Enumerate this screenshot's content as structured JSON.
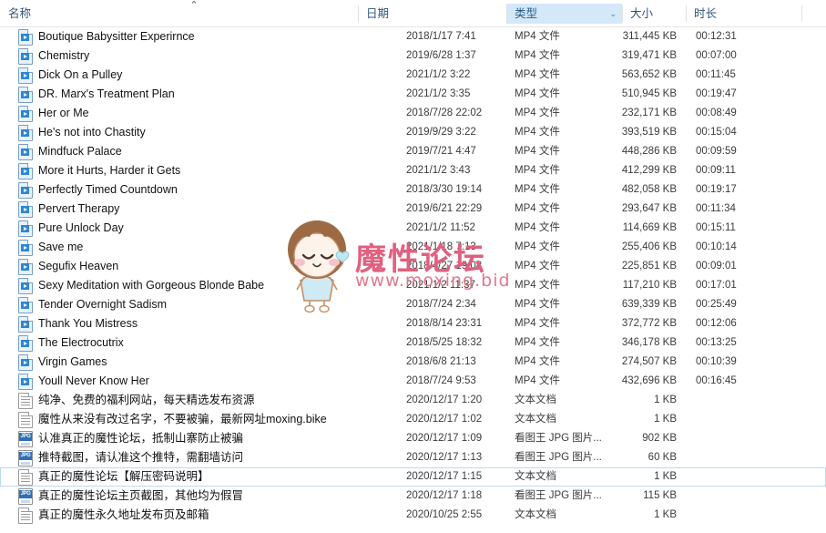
{
  "columns": {
    "name": "名称",
    "date": "日期",
    "type": "类型",
    "size": "大小",
    "duration": "时长",
    "sort_indicator": "⌃",
    "type_filter_chevron": "⌄"
  },
  "colors": {
    "header_text": "#30557b",
    "active_header_bg": "#d3e8f8",
    "selection_border": "#bcd9f0",
    "watermark": "#e0607f"
  },
  "watermark": {
    "title": "魔性论坛",
    "url": "www.moxing.bid"
  },
  "rows": [
    {
      "icon": "mp4-file-icon",
      "name": "Boutique Babysitter Experirnce",
      "date": "2018/1/17 7:41",
      "type": "MP4 文件",
      "size": "311,445 KB",
      "duration": "00:12:31",
      "selected": false
    },
    {
      "icon": "mp4-file-icon",
      "name": "Chemistry",
      "date": "2019/6/28 1:37",
      "type": "MP4 文件",
      "size": "319,471 KB",
      "duration": "00:07:00",
      "selected": false
    },
    {
      "icon": "mp4-file-icon",
      "name": "Dick On a Pulley",
      "date": "2021/1/2 3:22",
      "type": "MP4 文件",
      "size": "563,652 KB",
      "duration": "00:11:45",
      "selected": false
    },
    {
      "icon": "mp4-file-icon",
      "name": "DR. Marx's Treatment Plan",
      "date": "2021/1/2 3:35",
      "type": "MP4 文件",
      "size": "510,945 KB",
      "duration": "00:19:47",
      "selected": false
    },
    {
      "icon": "mp4-file-icon",
      "name": "Her or Me",
      "date": "2018/7/28 22:02",
      "type": "MP4 文件",
      "size": "232,171 KB",
      "duration": "00:08:49",
      "selected": false
    },
    {
      "icon": "mp4-file-icon",
      "name": "He's not into Chastity",
      "date": "2019/9/29 3:22",
      "type": "MP4 文件",
      "size": "393,519 KB",
      "duration": "00:15:04",
      "selected": false
    },
    {
      "icon": "mp4-file-icon",
      "name": "Mindfuck Palace",
      "date": "2019/7/21 4:47",
      "type": "MP4 文件",
      "size": "448,286 KB",
      "duration": "00:09:59",
      "selected": false
    },
    {
      "icon": "mp4-file-icon",
      "name": "More it Hurts, Harder it Gets",
      "date": "2021/1/2 3:43",
      "type": "MP4 文件",
      "size": "412,299 KB",
      "duration": "00:09:11",
      "selected": false
    },
    {
      "icon": "mp4-file-icon",
      "name": "Perfectly Timed Countdown",
      "date": "2018/3/30 19:14",
      "type": "MP4 文件",
      "size": "482,058 KB",
      "duration": "00:19:17",
      "selected": false
    },
    {
      "icon": "mp4-file-icon",
      "name": "Pervert Therapy",
      "date": "2019/6/21 22:29",
      "type": "MP4 文件",
      "size": "293,647 KB",
      "duration": "00:11:34",
      "selected": false
    },
    {
      "icon": "mp4-file-icon",
      "name": "Pure Unlock Day",
      "date": "2021/1/2 11:52",
      "type": "MP4 文件",
      "size": "114,669 KB",
      "duration": "00:15:11",
      "selected": false
    },
    {
      "icon": "mp4-file-icon",
      "name": "Save me",
      "date": "2021/1/18 7:13",
      "type": "MP4 文件",
      "size": "255,406 KB",
      "duration": "00:10:14",
      "selected": false
    },
    {
      "icon": "mp4-file-icon",
      "name": "Segufix Heaven",
      "date": "2018/4/27 19:08",
      "type": "MP4 文件",
      "size": "225,851 KB",
      "duration": "00:09:01",
      "selected": false
    },
    {
      "icon": "mp4-file-icon",
      "name": "Sexy Meditation with Gorgeous Blonde Babe",
      "date": "2021/1/2 11:37",
      "type": "MP4 文件",
      "size": "117,210 KB",
      "duration": "00:17:01",
      "selected": false
    },
    {
      "icon": "mp4-file-icon",
      "name": "Tender Overnight Sadism",
      "date": "2018/7/24 2:34",
      "type": "MP4 文件",
      "size": "639,339 KB",
      "duration": "00:25:49",
      "selected": false
    },
    {
      "icon": "mp4-file-icon",
      "name": "Thank You Mistress",
      "date": "2018/8/14 23:31",
      "type": "MP4 文件",
      "size": "372,772 KB",
      "duration": "00:12:06",
      "selected": false
    },
    {
      "icon": "mp4-file-icon",
      "name": "The Electrocutrix",
      "date": "2018/5/25 18:32",
      "type": "MP4 文件",
      "size": "346,178 KB",
      "duration": "00:13:25",
      "selected": false
    },
    {
      "icon": "mp4-file-icon",
      "name": "Virgin Games",
      "date": "2018/6/8 21:13",
      "type": "MP4 文件",
      "size": "274,507 KB",
      "duration": "00:10:39",
      "selected": false
    },
    {
      "icon": "mp4-file-icon",
      "name": "Youll Never Know Her",
      "date": "2018/7/24 9:53",
      "type": "MP4 文件",
      "size": "432,696 KB",
      "duration": "00:16:45",
      "selected": false
    },
    {
      "icon": "text-file-icon",
      "name": "纯净、免费的福利网站，每天精选发布资源",
      "date": "2020/12/17 1:20",
      "type": "文本文档",
      "size": "1 KB",
      "duration": "",
      "selected": false
    },
    {
      "icon": "text-file-icon",
      "name": "魔性从来没有改过名字，不要被骗，最新网址moxing.bike",
      "date": "2020/12/17 1:02",
      "type": "文本文档",
      "size": "1 KB",
      "duration": "",
      "selected": false
    },
    {
      "icon": "jpg-file-icon",
      "name": "认准真正的魔性论坛，抵制山寨防止被骗",
      "date": "2020/12/17 1:09",
      "type": "看图王 JPG 图片...",
      "size": "902 KB",
      "duration": "",
      "selected": false
    },
    {
      "icon": "jpg-file-icon",
      "name": "推特截图，请认准这个推特，需翻墙访问",
      "date": "2020/12/17 1:13",
      "type": "看图王 JPG 图片...",
      "size": "60 KB",
      "duration": "",
      "selected": false
    },
    {
      "icon": "text-file-icon",
      "name": "真正的魔性论坛【解压密码说明】",
      "date": "2020/12/17 1:15",
      "type": "文本文档",
      "size": "1 KB",
      "duration": "",
      "selected": true
    },
    {
      "icon": "jpg-file-icon",
      "name": "真正的魔性论坛主页截图，其他均为假冒",
      "date": "2020/12/17 1:18",
      "type": "看图王 JPG 图片...",
      "size": "115 KB",
      "duration": "",
      "selected": false
    },
    {
      "icon": "text-file-icon",
      "name": "真正的魔性永久地址发布页及邮箱",
      "date": "2020/10/25 2:55",
      "type": "文本文档",
      "size": "1 KB",
      "duration": "",
      "selected": false
    }
  ]
}
